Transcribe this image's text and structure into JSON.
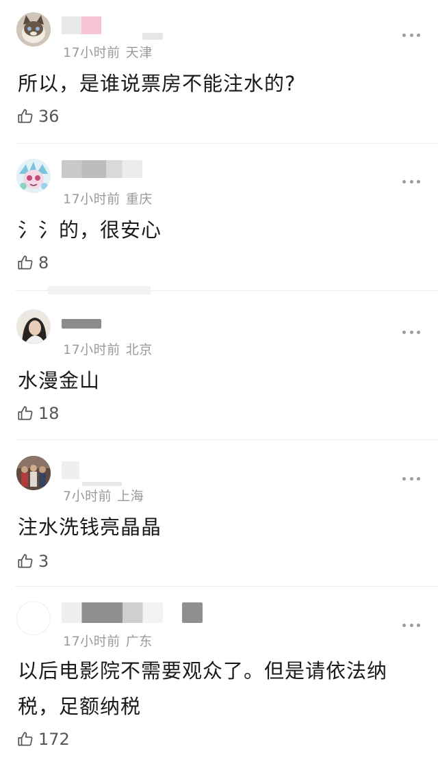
{
  "comments": [
    {
      "time": "17小时前",
      "location": "天津",
      "text": "所以，是谁说票房不能注水的?",
      "likes": "36",
      "avatar_icon": "cat-avatar-icon"
    },
    {
      "time": "17小时前",
      "location": "重庆",
      "text": "氵氵的，很安心",
      "likes": "8",
      "avatar_icon": "cartoon-avatar-icon"
    },
    {
      "time": "17小时前",
      "location": "北京",
      "text": "水漫金山",
      "likes": "18",
      "avatar_icon": "person-avatar-icon"
    },
    {
      "time": "7小时前",
      "location": "上海",
      "text": "注水洗钱亮晶晶",
      "likes": "3",
      "avatar_icon": "crowd-avatar-icon"
    },
    {
      "time": "17小时前",
      "location": "广东",
      "text": "以后电影院不需要观众了。但是请依法纳税，足额纳税",
      "likes": "172",
      "avatar_icon": "blank-avatar-icon"
    }
  ],
  "colors": {
    "meta": "#9a9a9a",
    "text": "#1a1a1a",
    "divider": "#ececec",
    "more_dots": "#9b9b9b"
  }
}
